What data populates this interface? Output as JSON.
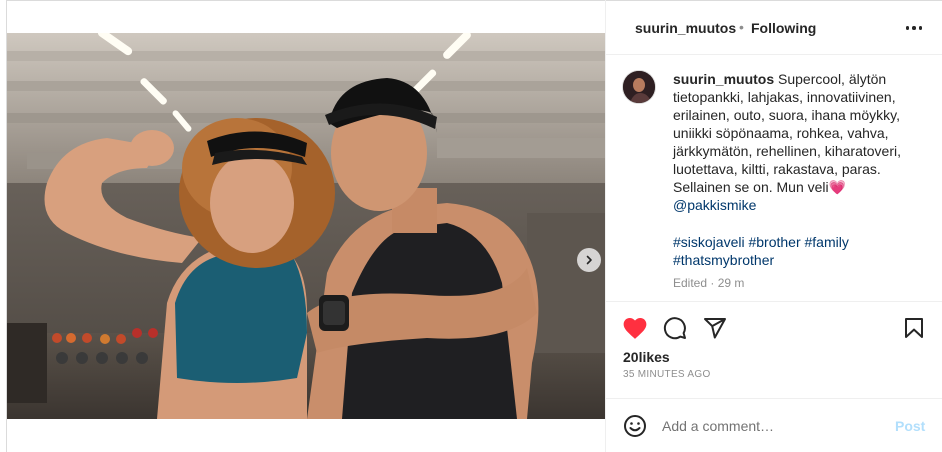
{
  "post": {
    "username": "suurin_muutos",
    "separator": "•",
    "follow_status": "Following",
    "more_label": "More options",
    "caption_lines": [
      "Supercool, älytön",
      "tietopankki, lahjakas, innovatiivinen,",
      "erilainen, outo, suora, ihana möykky,",
      "uniikki söpönaama, rohkea, vahva,",
      "järkkymätön, rehellinen, kiharatoveri,",
      "luotettava, kiltti, rakastava, paras.",
      "Sellainen se on. Mun veli💗"
    ],
    "mention": "@pakkismike",
    "hashtags_line1": "#siskojaveli #brother #family",
    "hashtags_line2": "#thatsmybrother",
    "edited": "Edited · 29 m",
    "likes": "20likes",
    "time_ago": "35 MINUTES AGO",
    "comment_placeholder": "Add a comment…",
    "post_label": "Post",
    "carousel_index": 1,
    "carousel_count": 2,
    "liked": true
  },
  "icons": {
    "like": "heart-filled-icon",
    "comment": "comment-bubble-icon",
    "share": "paper-plane-icon",
    "save": "bookmark-icon",
    "emoji": "smiley-icon",
    "next": "chevron-right-icon",
    "more": "ellipsis-icon"
  },
  "colors": {
    "like_red": "#ff3040",
    "link_blue": "#00376b",
    "post_disabled": "#b2dffc",
    "muted": "#8e8e8e"
  }
}
